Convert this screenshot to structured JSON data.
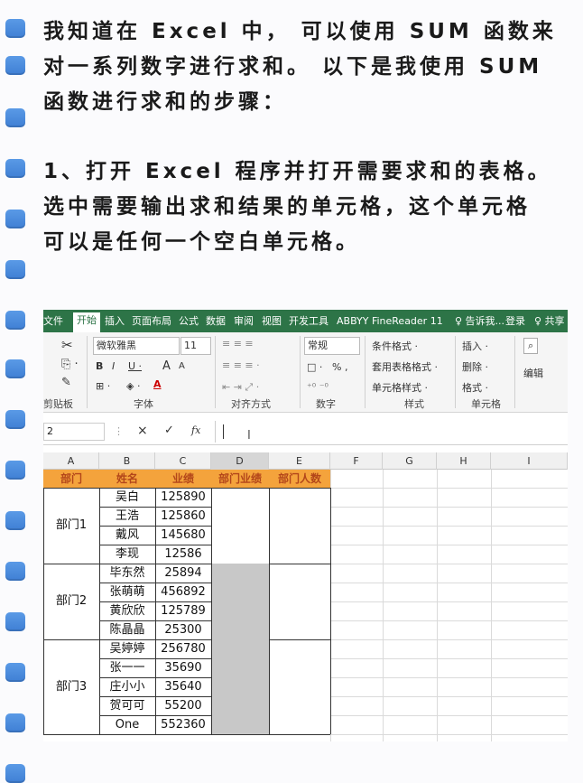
{
  "paragraph1": [
    "我知道在 Excel 中， 可以使用 SUM 函数来",
    "对一系列数字进行求和。 以下是我使用 SUM",
    "函数进行求和的步骤："
  ],
  "paragraph2": [
    "1、打开 Excel 程序并打开需要求和的表格。",
    "选中需要输出求和结果的单元格，这个单元格",
    "可以是任何一个空白单元格。"
  ],
  "excel": {
    "tabs": [
      "文件",
      "开始",
      "插入",
      "页面布局",
      "公式",
      "数据",
      "审阅",
      "视图",
      "开发工具",
      "ABBYY FineReader 11",
      "♀ 告诉我...",
      "登录",
      "♀ 共享"
    ],
    "ribbon": {
      "font_name": "微软雅黑",
      "font_size": "11",
      "number_format": "常规",
      "cond_format": "条件格式 ·",
      "table_format": "套用表格格式 ·",
      "cell_style": "单元格样式 ·",
      "insert": "插入 ·",
      "delete": "删除 ·",
      "format": "格式 ·",
      "edit": "编辑",
      "clipboard_label": "剪贴板",
      "font_label": "字体",
      "align_label": "对齐方式",
      "number_label": "数字",
      "style_label": "样式",
      "cells_label": "单元格",
      "bold": "B",
      "italic": "I",
      "underline": "U ·",
      "grow": "A",
      "shrink": "A",
      "percent": "% ,",
      "currency": "□ ·"
    },
    "formula_bar": {
      "name_box": "2",
      "cancel": "×",
      "enter": "✓",
      "fx": "fx"
    },
    "columns": [
      "A",
      "B",
      "C",
      "D",
      "E",
      "F",
      "G",
      "H",
      "I"
    ],
    "headers": [
      "部门",
      "姓名",
      "业绩",
      "部门业绩",
      "部门人数"
    ],
    "groups": [
      {
        "name": "部门1",
        "rows": [
          [
            "吴白",
            "125890"
          ],
          [
            "王浩",
            "125860"
          ],
          [
            "戴风",
            "145680"
          ],
          [
            "李现",
            "12586"
          ]
        ]
      },
      {
        "name": "部门2",
        "rows": [
          [
            "毕东然",
            "25894"
          ],
          [
            "张萌萌",
            "456892"
          ],
          [
            "黄欣欣",
            "125789"
          ],
          [
            "陈晶晶",
            "25300"
          ]
        ]
      },
      {
        "name": "部门3",
        "rows": [
          [
            "吴婷婷",
            "256780"
          ],
          [
            "张一一",
            "35690"
          ],
          [
            "庄小小",
            "35640"
          ],
          [
            "贺可可",
            "55200"
          ],
          [
            "One",
            "552360"
          ]
        ]
      }
    ]
  }
}
